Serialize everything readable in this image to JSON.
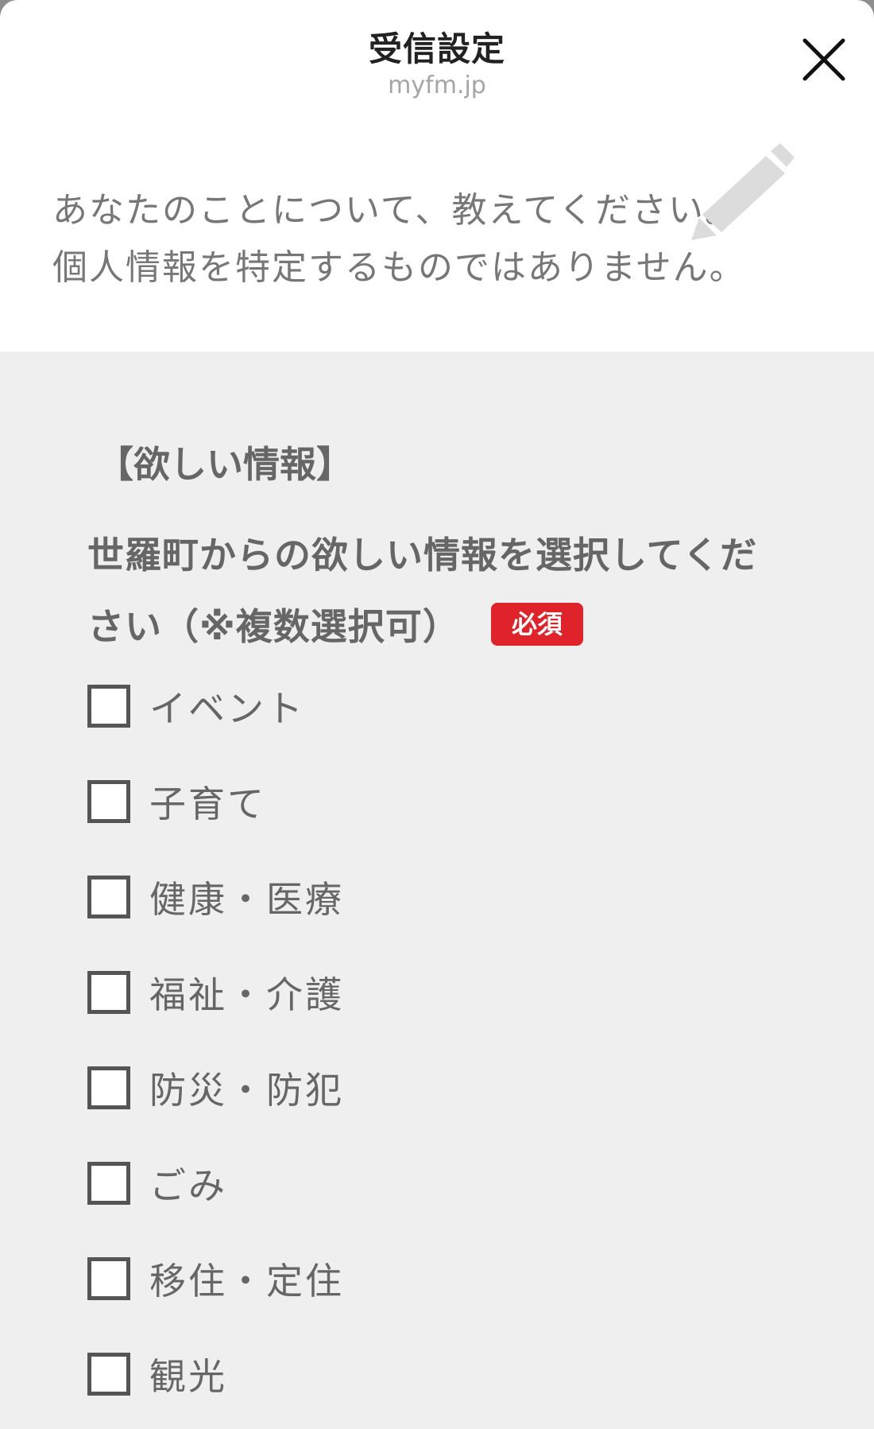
{
  "header": {
    "title": "受信設定",
    "subtitle": "myfm.jp"
  },
  "intro": {
    "line1": "あなたのことについて、教えてください。",
    "line2": "個人情報を特定するものではありません。"
  },
  "form": {
    "section_title": "【欲しい情報】",
    "question_line1": "世羅町からの欲しい情報を選択してくだ",
    "question_line2": "さい（※複数選択可）",
    "required_label": "必須",
    "options": [
      {
        "label": "イベント",
        "checked": false
      },
      {
        "label": "子育て",
        "checked": false
      },
      {
        "label": "健康・医療",
        "checked": false
      },
      {
        "label": "福祉・介護",
        "checked": false
      },
      {
        "label": "防災・防犯",
        "checked": false
      },
      {
        "label": "ごみ",
        "checked": false
      },
      {
        "label": "移住・定住",
        "checked": false
      },
      {
        "label": "観光",
        "checked": false
      }
    ]
  },
  "icons": {
    "close": "close-icon",
    "pencil": "pencil-icon"
  },
  "colors": {
    "required_badge": "#e0232a",
    "form_background": "#efefef",
    "text_gray": "#666666"
  }
}
